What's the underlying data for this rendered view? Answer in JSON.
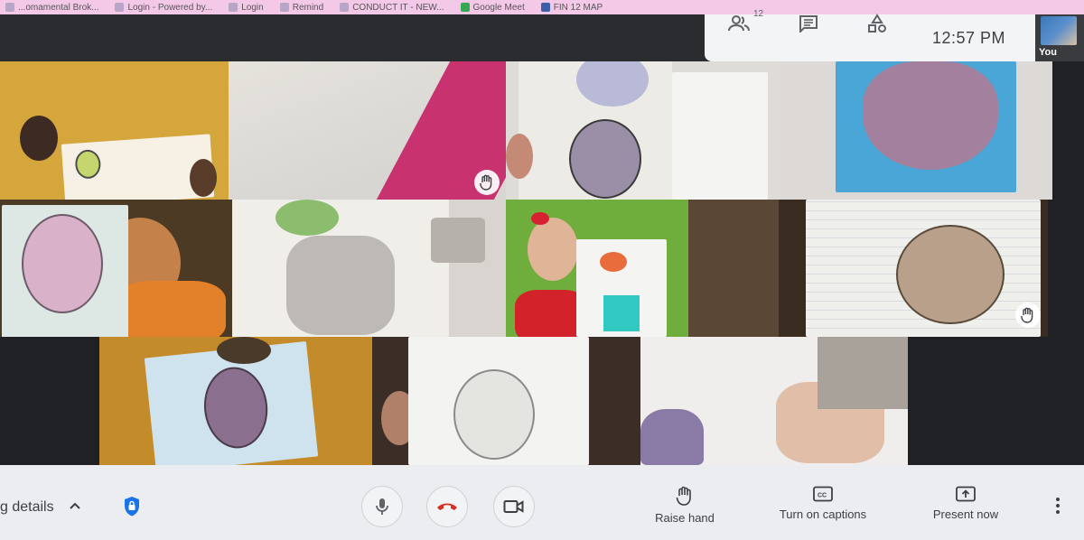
{
  "bookmarks": [
    {
      "label": "...omamental Brok..."
    },
    {
      "label": "Login - Powered by..."
    },
    {
      "label": "Login"
    },
    {
      "label": "Remind"
    },
    {
      "label": "CONDUCT IT - NEW..."
    },
    {
      "label": "Google Meet"
    },
    {
      "label": "FIN 12 MAP"
    }
  ],
  "top_bar": {
    "participants_count": "12",
    "clock": "12:57 PM",
    "self_label": "You"
  },
  "bottom_bar": {
    "meeting_details_label": "g details",
    "raise_hand_label": "Raise hand",
    "captions_label": "Turn on captions",
    "present_label": "Present now"
  },
  "colors": {
    "bookmark_bar": "#f4c9e8",
    "top_panel": "#f3f4f6",
    "bottom_bar": "#ecedf0",
    "hangup_red": "#d93025",
    "shield_blue": "#1a73e8"
  },
  "icons": [
    "people-icon",
    "chat-icon",
    "activities-icon",
    "hand-icon",
    "microphone-icon",
    "hangup-icon",
    "camera-icon",
    "captions-icon",
    "present-icon",
    "more-vert-icon",
    "chevron-up-icon",
    "shield-icon"
  ]
}
